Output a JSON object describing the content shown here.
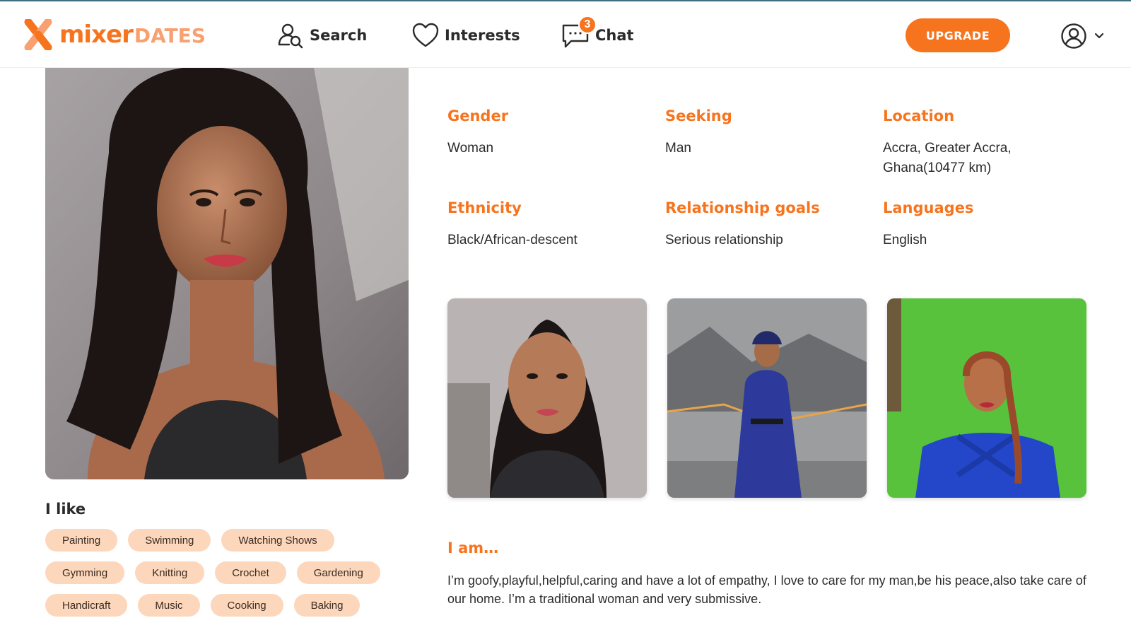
{
  "header": {
    "logo_text_main": "mixer",
    "logo_text_accent": "DATES",
    "nav": {
      "search_label": "Search",
      "interests_label": "Interests",
      "chat_label": "Chat",
      "chat_badge": "3"
    },
    "upgrade_label": "UPGRADE",
    "icons": [
      "logo-x-icon",
      "search-user-icon",
      "heart-icon",
      "chat-bubble-icon",
      "user-circle-icon",
      "chevron-down-icon"
    ]
  },
  "profile": {
    "info": {
      "gender": {
        "label": "Gender",
        "value": "Woman"
      },
      "seeking": {
        "label": "Seeking",
        "value": "Man"
      },
      "location": {
        "label": "Location",
        "value_line1": "Accra, Greater Accra,",
        "value_line2": "Ghana(10477 km)"
      },
      "ethnicity": {
        "label": "Ethnicity",
        "value": "Black/African-descent"
      },
      "relationship_goals": {
        "label": "Relationship goals",
        "value": "Serious relationship"
      },
      "languages": {
        "label": "Languages",
        "value": "English"
      }
    },
    "likes": {
      "title": "I like",
      "rows": [
        [
          "Painting",
          "Swimming",
          "Watching Shows"
        ],
        [
          "Gymming",
          "Knitting",
          "Crochet",
          "Gardening"
        ],
        [
          "Handicraft",
          "Music",
          "Cooking",
          "Baking"
        ]
      ]
    },
    "about": {
      "title": "I am…",
      "text": "I’m goofy,playful,helpful,caring and have a lot of empathy, I love to care for my man,be his peace,also take care of our home. I’m a traditional woman and very submissive."
    }
  },
  "colors": {
    "brand_orange": "#f7741e",
    "tag_background": "#fcd7bc",
    "top_line": "#3c6f80"
  }
}
